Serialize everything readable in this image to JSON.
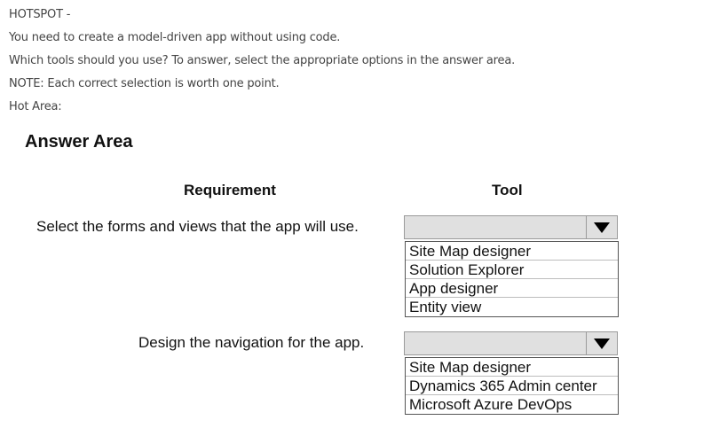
{
  "intro": {
    "line1": "HOTSPOT -",
    "line2": "You need to create a model-driven app without using code.",
    "line3": "Which tools should you use? To answer, select the appropriate options in the answer area.",
    "line4": "NOTE: Each correct selection is worth one point.",
    "line5": "Hot Area:"
  },
  "answer_area": {
    "title": "Answer Area",
    "col_requirement": "Requirement",
    "col_tool": "Tool",
    "rows": [
      {
        "requirement": "Select the forms and views that the app will use.",
        "selected": "",
        "options": [
          "Site Map designer",
          "Solution Explorer",
          "App designer",
          "Entity view"
        ]
      },
      {
        "requirement": "Design the navigation for the app.",
        "selected": "",
        "options": [
          "Site Map designer",
          "Dynamics 365 Admin center",
          "Microsoft Azure DevOps"
        ]
      }
    ]
  },
  "icons": {
    "dropdown_arrow": "triangle-down-icon"
  }
}
